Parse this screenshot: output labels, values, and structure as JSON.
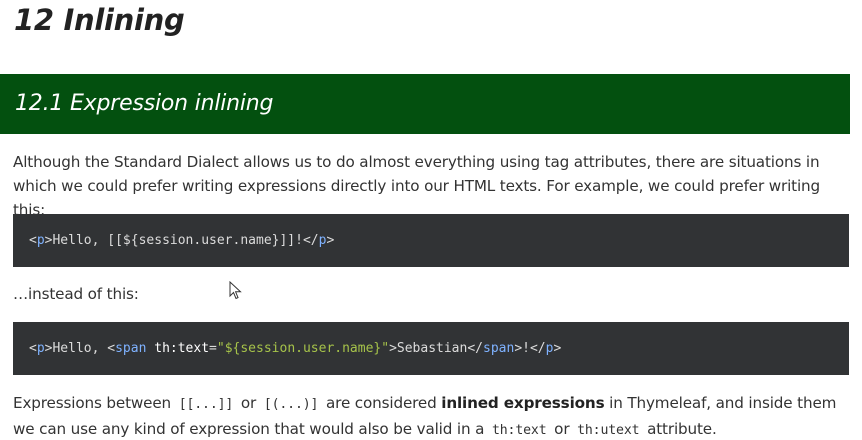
{
  "heading": {
    "title": "12 Inlining"
  },
  "section": {
    "title": "12.1 Expression inlining"
  },
  "paragraph1": "Although the Standard Dialect allows us to do almost everything using tag attributes, there are situations in which we could prefer writing expressions directly into our HTML texts. For example, we could prefer writing this:",
  "code1": {
    "open_tag": "p",
    "text_before": "Hello, ",
    "expression": "[[${session.user.name}]]",
    "text_after": "!",
    "close_tag": "p"
  },
  "paragraph2": "…instead of this:",
  "code2": {
    "open_tag": "p",
    "text_before": "Hello, ",
    "span_tag": "span",
    "attr_name": "th:text",
    "attr_value": "\"${session.user.name}\"",
    "span_text": "Sebastian",
    "span_close": "span",
    "text_after": "!",
    "close_tag": "p"
  },
  "paragraph3": {
    "part1": "Expressions between ",
    "code_a": "[[...]]",
    "part2": " or ",
    "code_b": "[(...)]",
    "part3": " are considered ",
    "bold": "inlined expressions",
    "part4": " in Thymeleaf, and inside them we can use any kind of expression that would also be valid in a ",
    "code_c": "th:text",
    "part5": " or ",
    "code_d": "th:utext",
    "part6": " attribute."
  }
}
